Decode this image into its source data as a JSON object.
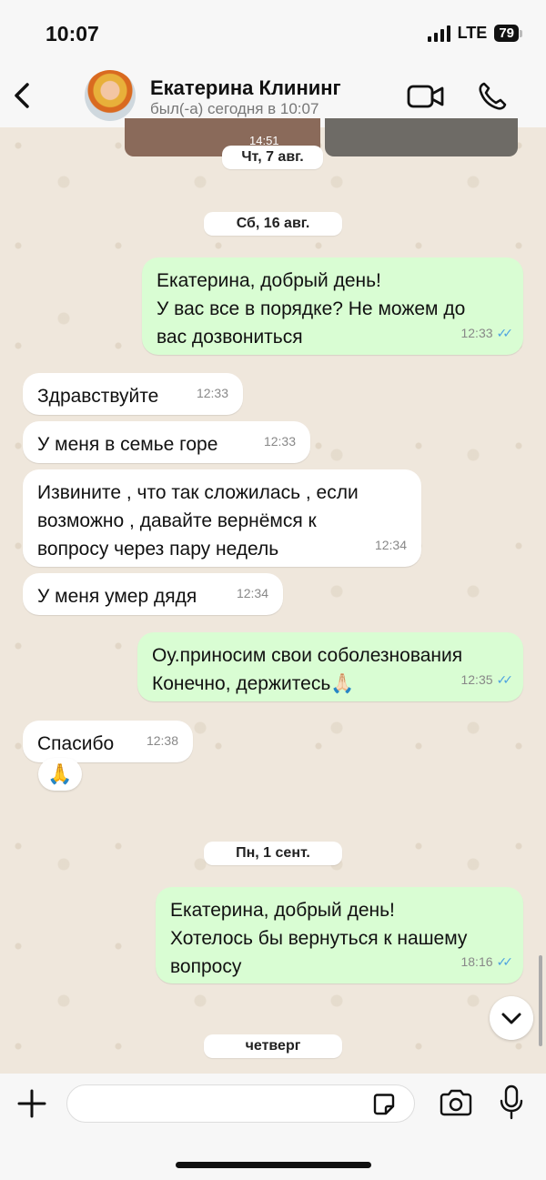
{
  "status_bar": {
    "time": "10:07",
    "network": "LTE",
    "battery": "79"
  },
  "header": {
    "contact_name": "Екатерина Клининг",
    "contact_status": "был(-а) сегодня в 10:07"
  },
  "chat": {
    "prev_thumb_time": "14:51",
    "dates": {
      "thu": "Чт, 7 авг.",
      "sat": "Сб, 16 авг.",
      "mon": "Пн, 1 сент.",
      "thursday": "четверг"
    },
    "messages": [
      {
        "dir": "out",
        "text": "Екатерина, добрый день!\nУ вас все в порядке? Не можем до\nвас дозвониться",
        "time": "12:33",
        "read": true
      },
      {
        "dir": "in",
        "text": "Здравствуйте",
        "time": "12:33"
      },
      {
        "dir": "in",
        "text": "У меня в семье горе",
        "time": "12:33"
      },
      {
        "dir": "in",
        "text": "Извините , что так сложилась , если\nвозможно , давайте вернёмся к\nвопросу через пару недель",
        "time": "12:34"
      },
      {
        "dir": "in",
        "text": "У меня умер дядя",
        "time": "12:34"
      },
      {
        "dir": "out",
        "text": "Оу.приносим свои соболезнования\nКонечно, держитесь🙏🏻",
        "time": "12:35",
        "read": true
      },
      {
        "dir": "in",
        "text": "Спасибо",
        "time": "12:38",
        "reaction": "🙏"
      },
      {
        "dir": "out",
        "text": "Екатерина, добрый день!\nХотелось бы вернуться к нашему\nвопросу",
        "time": "18:16",
        "read": true
      }
    ]
  },
  "input": {
    "placeholder": ""
  },
  "colors": {
    "outgoing": "#d9fdd3",
    "incoming": "#ffffff",
    "tick": "#4fa3e0",
    "background": "#efe7dc"
  }
}
